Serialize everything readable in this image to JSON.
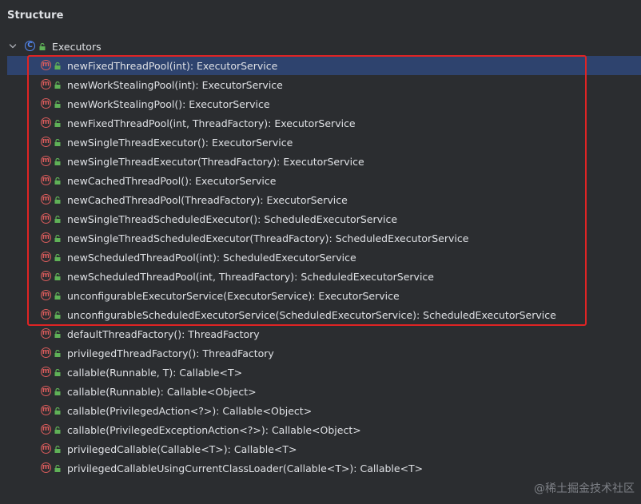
{
  "panel": {
    "title": "Structure"
  },
  "tree": {
    "root": {
      "label": "Executors",
      "kind_icon": "class-icon"
    },
    "methods": [
      {
        "label": "newFixedThreadPool(int): ExecutorService",
        "selected": true
      },
      {
        "label": "newWorkStealingPool(int): ExecutorService"
      },
      {
        "label": "newWorkStealingPool(): ExecutorService"
      },
      {
        "label": "newFixedThreadPool(int, ThreadFactory): ExecutorService"
      },
      {
        "label": "newSingleThreadExecutor(): ExecutorService"
      },
      {
        "label": "newSingleThreadExecutor(ThreadFactory): ExecutorService"
      },
      {
        "label": "newCachedThreadPool(): ExecutorService"
      },
      {
        "label": "newCachedThreadPool(ThreadFactory): ExecutorService"
      },
      {
        "label": "newSingleThreadScheduledExecutor(): ScheduledExecutorService"
      },
      {
        "label": "newSingleThreadScheduledExecutor(ThreadFactory): ScheduledExecutorService"
      },
      {
        "label": "newScheduledThreadPool(int): ScheduledExecutorService"
      },
      {
        "label": "newScheduledThreadPool(int, ThreadFactory): ScheduledExecutorService"
      },
      {
        "label": "unconfigurableExecutorService(ExecutorService): ExecutorService"
      },
      {
        "label": "unconfigurableScheduledExecutorService(ScheduledExecutorService): ScheduledExecutorService"
      },
      {
        "label": "defaultThreadFactory(): ThreadFactory"
      },
      {
        "label": "privilegedThreadFactory(): ThreadFactory"
      },
      {
        "label": "callable(Runnable, T): Callable<T>"
      },
      {
        "label": "callable(Runnable): Callable<Object>"
      },
      {
        "label": "callable(PrivilegedAction<?>): Callable<Object>"
      },
      {
        "label": "callable(PrivilegedExceptionAction<?>): Callable<Object>"
      },
      {
        "label": "privilegedCallable(Callable<T>): Callable<T>"
      },
      {
        "label": "privilegedCallableUsingCurrentClassLoader(Callable<T>): Callable<T>"
      }
    ]
  },
  "icons": {
    "class_badge_letter": "C",
    "method_badge_letter": "m",
    "class_color": "#548af7",
    "method_color": "#db5c5c",
    "public_lock_color": "#5fb157",
    "highlight_color": "#e02424"
  },
  "watermark": "@稀土掘金技术社区"
}
